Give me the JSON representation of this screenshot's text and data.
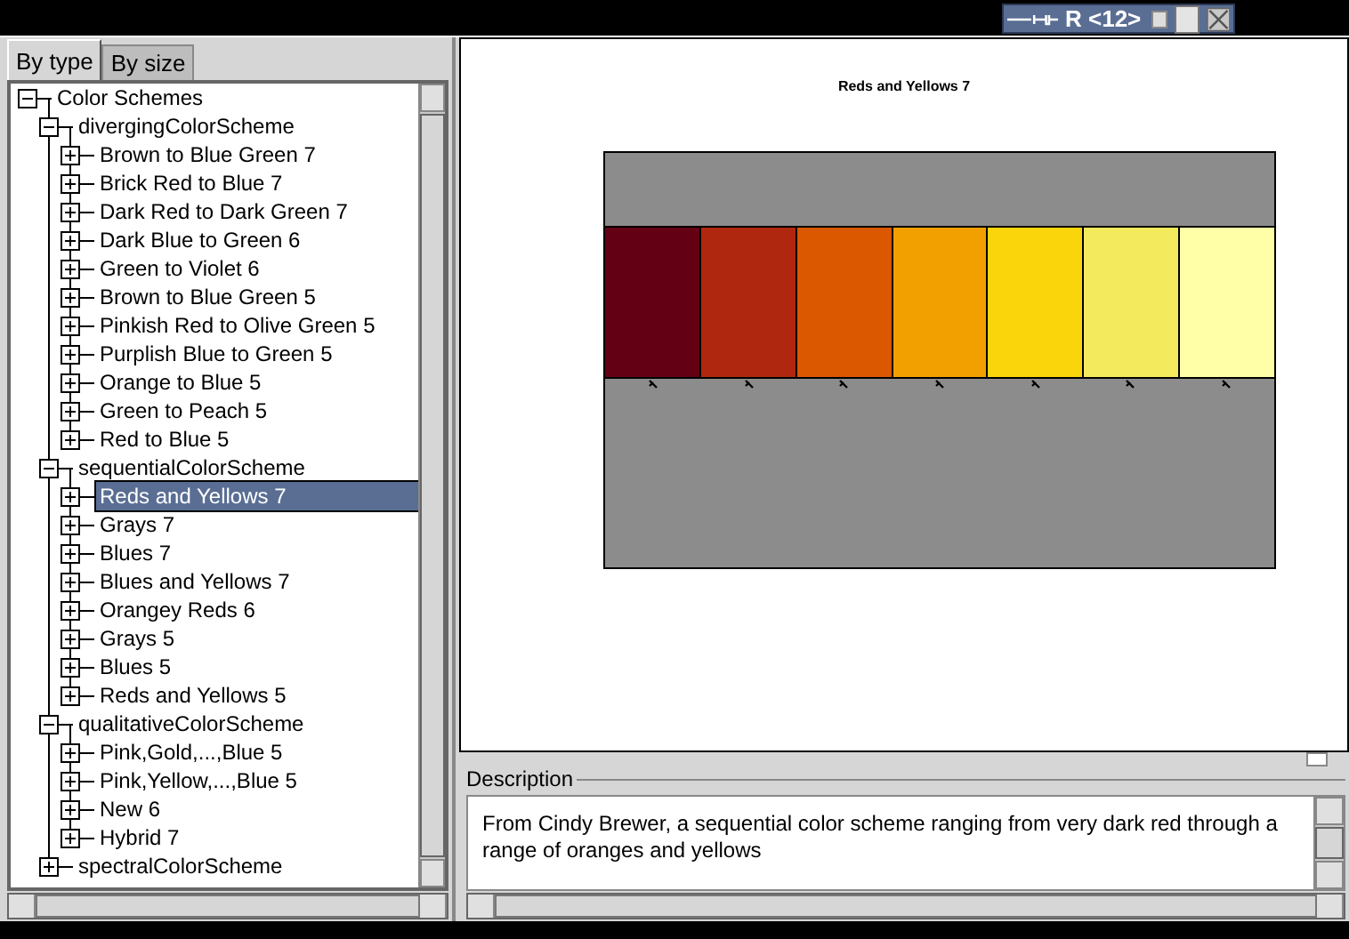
{
  "window": {
    "title": "R <12>"
  },
  "tabs": [
    {
      "label": "By type",
      "selected": true
    },
    {
      "label": "By size",
      "selected": false
    }
  ],
  "tree": [
    {
      "label": "Color Schemes",
      "expanded": true,
      "selected": false,
      "children": [
        {
          "label": "divergingColorScheme",
          "expanded": true,
          "selected": false,
          "children": [
            {
              "label": "Brown to Blue Green 7",
              "expanded": false,
              "selected": false
            },
            {
              "label": "Brick Red to Blue 7",
              "expanded": false,
              "selected": false
            },
            {
              "label": "Dark Red to Dark Green 7",
              "expanded": false,
              "selected": false
            },
            {
              "label": "Dark Blue to Green 6",
              "expanded": false,
              "selected": false
            },
            {
              "label": "Green to Violet 6",
              "expanded": false,
              "selected": false
            },
            {
              "label": "Brown to Blue Green 5",
              "expanded": false,
              "selected": false
            },
            {
              "label": "Pinkish Red to Olive Green 5",
              "expanded": false,
              "selected": false
            },
            {
              "label": "Purplish Blue to Green 5",
              "expanded": false,
              "selected": false
            },
            {
              "label": "Orange to Blue 5",
              "expanded": false,
              "selected": false
            },
            {
              "label": "Green to Peach 5",
              "expanded": false,
              "selected": false
            },
            {
              "label": "Red to Blue 5",
              "expanded": false,
              "selected": false
            }
          ]
        },
        {
          "label": "sequentialColorScheme",
          "expanded": true,
          "selected": false,
          "children": [
            {
              "label": "Reds and Yellows 7",
              "expanded": false,
              "selected": true
            },
            {
              "label": "Grays 7",
              "expanded": false,
              "selected": false
            },
            {
              "label": "Blues 7",
              "expanded": false,
              "selected": false
            },
            {
              "label": "Blues and Yellows 7",
              "expanded": false,
              "selected": false
            },
            {
              "label": "Orangey Reds 6",
              "expanded": false,
              "selected": false
            },
            {
              "label": "Grays 5",
              "expanded": false,
              "selected": false
            },
            {
              "label": "Blues 5",
              "expanded": false,
              "selected": false
            },
            {
              "label": "Reds and Yellows 5",
              "expanded": false,
              "selected": false
            }
          ]
        },
        {
          "label": "qualitativeColorScheme",
          "expanded": true,
          "selected": false,
          "children": [
            {
              "label": "Pink,Gold,...,Blue 5",
              "expanded": false,
              "selected": false
            },
            {
              "label": "Pink,Yellow,...,Blue 5",
              "expanded": false,
              "selected": false
            },
            {
              "label": "New 6",
              "expanded": false,
              "selected": false
            },
            {
              "label": "Hybrid 7",
              "expanded": false,
              "selected": false
            }
          ]
        },
        {
          "label": "spectralColorScheme",
          "expanded": false,
          "selected": false
        }
      ]
    }
  ],
  "preview": {
    "title": "Reds and Yellows 7",
    "swatches": [
      {
        "color": "#630013"
      },
      {
        "color": "#b0270f"
      },
      {
        "color": "#db5800"
      },
      {
        "color": "#f2a000"
      },
      {
        "color": "#fad50b"
      },
      {
        "color": "#f4ea5e"
      },
      {
        "color": "#ffffa8"
      }
    ]
  },
  "description": {
    "heading": "Description",
    "text": "From Cindy Brewer, a sequential color scheme ranging from very dark red through a range of oranges and yellows"
  }
}
